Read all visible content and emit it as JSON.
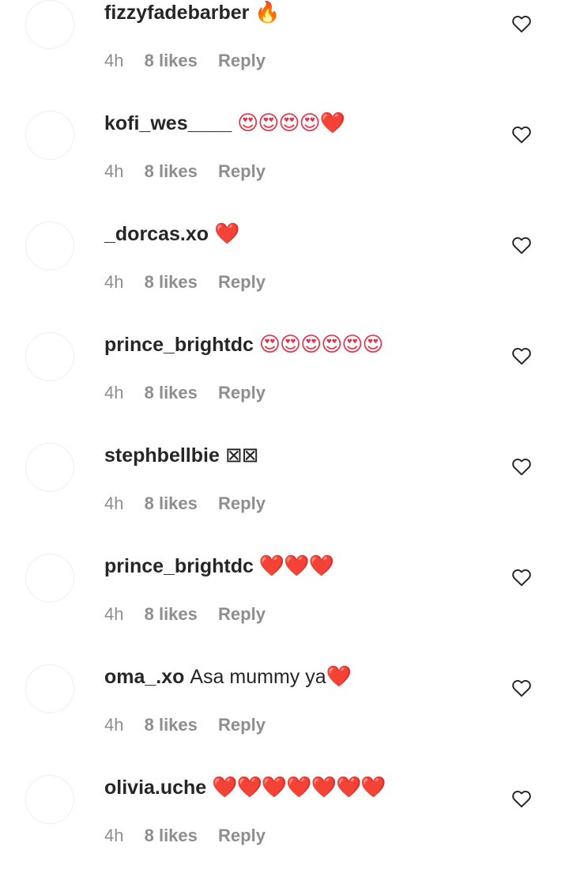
{
  "comments": [
    {
      "username": "fizzyfadebarber",
      "text": "",
      "emoji": "🔥",
      "emoji_color": "#f57c00",
      "time": "4h",
      "likes": "8 likes",
      "reply": "Reply"
    },
    {
      "username": "kofi_wes____",
      "text": "",
      "emoji": "😍😍😍😍❤️",
      "emoji_color": "#e5334b",
      "time": "4h",
      "likes": "8 likes",
      "reply": "Reply"
    },
    {
      "username": "_dorcas.xo",
      "text": "",
      "emoji": "❤️",
      "emoji_color": "#e0202f",
      "time": "4h",
      "likes": "8 likes",
      "reply": "Reply"
    },
    {
      "username": "prince_brightdc",
      "text": "",
      "emoji": "😍😍😍😍😍😍",
      "emoji_color": "#e5334b",
      "time": "4h",
      "likes": "8 likes",
      "reply": "Reply"
    },
    {
      "username": "stephbellbie",
      "text": "",
      "emoji": "⊠⊠",
      "emoji_color": "#262626",
      "time": "4h",
      "likes": "8 likes",
      "reply": "Reply"
    },
    {
      "username": "prince_brightdc",
      "text": "",
      "emoji": "❤️❤️❤️",
      "emoji_color": "#e0202f",
      "time": "4h",
      "likes": "8 likes",
      "reply": "Reply"
    },
    {
      "username": "oma_.xo",
      "text": "Asa mummy ya",
      "emoji": "❤️",
      "emoji_color": "#e0202f",
      "time": "4h",
      "likes": "8 likes",
      "reply": "Reply"
    },
    {
      "username": "olivia.uche",
      "text": "",
      "emoji": "❤️❤️❤️❤️❤️❤️❤️",
      "emoji_color": "#e0202f",
      "time": "4h",
      "likes": "8 likes",
      "reply": "Reply"
    }
  ],
  "icons": {
    "like": "heart-outline-icon"
  },
  "colors": {
    "primary_text": "#262626",
    "secondary_text": "#8e8e8e",
    "avatar_border": "#efefef"
  }
}
